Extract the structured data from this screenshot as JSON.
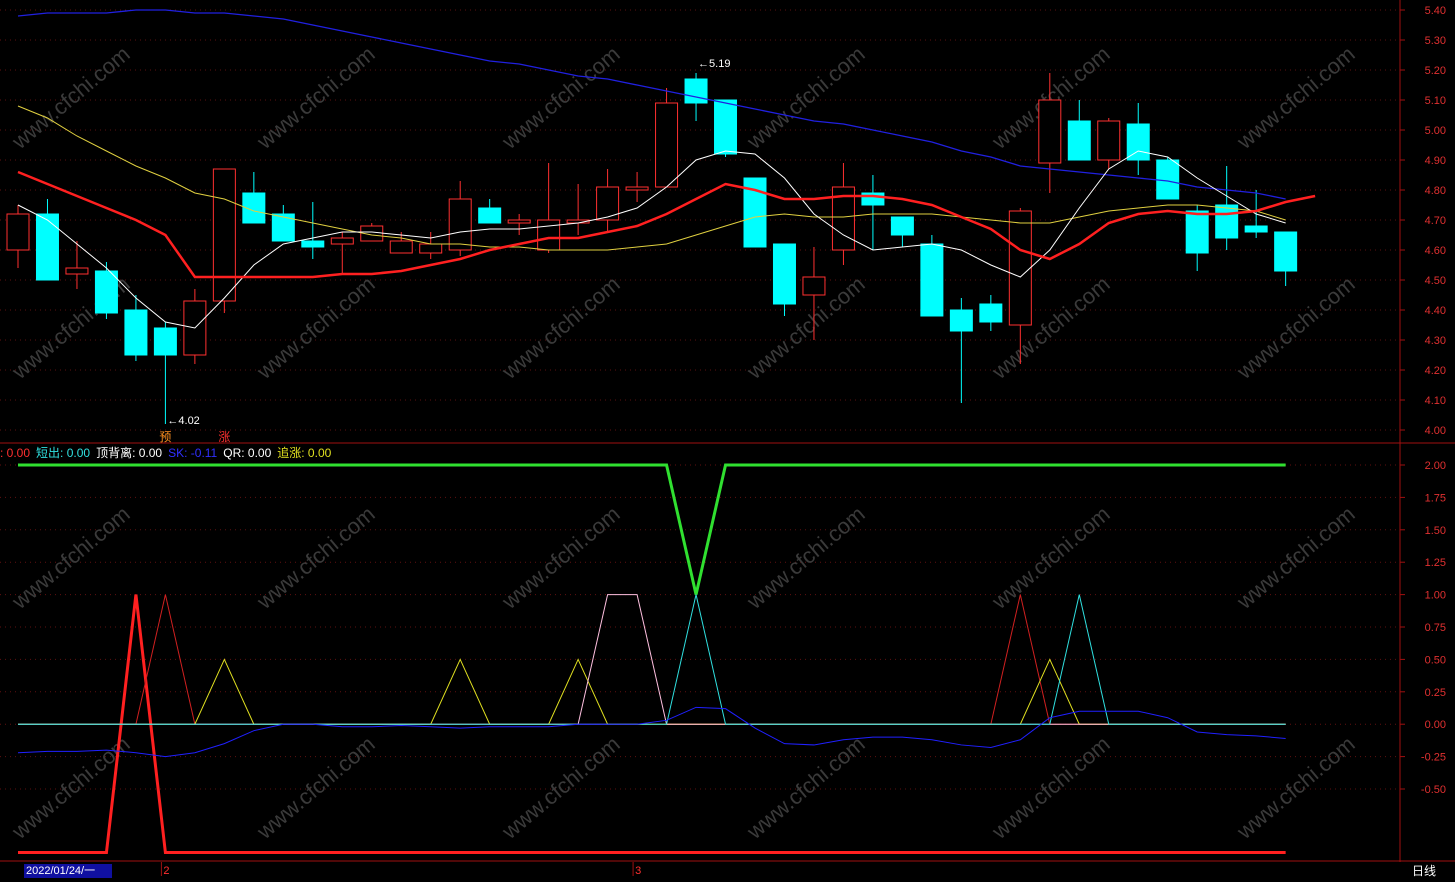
{
  "chart_data": [
    {
      "type": "candlestick",
      "ylim": [
        3.96,
        5.4
      ],
      "y_ticks": [
        "5.40",
        "5.30",
        "5.20",
        "5.10",
        "5.00",
        "4.90",
        "4.80",
        "4.70",
        "4.60",
        "4.50",
        "4.40",
        "4.30",
        "4.20",
        "4.10",
        "4.00"
      ],
      "candles": [
        {
          "o": 4.6,
          "h": 4.75,
          "l": 4.54,
          "c": 4.72
        },
        {
          "o": 4.72,
          "h": 4.77,
          "l": 4.5,
          "c": 4.5
        },
        {
          "o": 4.52,
          "h": 4.63,
          "l": 4.47,
          "c": 4.54
        },
        {
          "o": 4.53,
          "h": 4.56,
          "l": 4.37,
          "c": 4.39
        },
        {
          "o": 4.4,
          "h": 4.45,
          "l": 4.23,
          "c": 4.25
        },
        {
          "o": 4.34,
          "h": 4.36,
          "l": 4.02,
          "c": 4.25
        },
        {
          "o": 4.25,
          "h": 4.47,
          "l": 4.22,
          "c": 4.43
        },
        {
          "o": 4.43,
          "h": 4.87,
          "l": 4.39,
          "c": 4.87
        },
        {
          "o": 4.79,
          "h": 4.86,
          "l": 4.69,
          "c": 4.69
        },
        {
          "o": 4.72,
          "h": 4.75,
          "l": 4.63,
          "c": 4.63
        },
        {
          "o": 4.63,
          "h": 4.76,
          "l": 4.57,
          "c": 4.61
        },
        {
          "o": 4.62,
          "h": 4.66,
          "l": 4.52,
          "c": 4.64
        },
        {
          "o": 4.63,
          "h": 4.69,
          "l": 4.63,
          "c": 4.68
        },
        {
          "o": 4.59,
          "h": 4.66,
          "l": 4.59,
          "c": 4.63
        },
        {
          "o": 4.59,
          "h": 4.66,
          "l": 4.57,
          "c": 4.62
        },
        {
          "o": 4.6,
          "h": 4.83,
          "l": 4.58,
          "c": 4.77
        },
        {
          "o": 4.74,
          "h": 4.77,
          "l": 4.69,
          "c": 4.69
        },
        {
          "o": 4.69,
          "h": 4.72,
          "l": 4.65,
          "c": 4.7
        },
        {
          "o": 4.6,
          "h": 4.89,
          "l": 4.59,
          "c": 4.7
        },
        {
          "o": 4.69,
          "h": 4.82,
          "l": 4.65,
          "c": 4.7
        },
        {
          "o": 4.7,
          "h": 4.87,
          "l": 4.66,
          "c": 4.81
        },
        {
          "o": 4.8,
          "h": 4.86,
          "l": 4.76,
          "c": 4.81
        },
        {
          "o": 4.81,
          "h": 5.14,
          "l": 4.81,
          "c": 5.09
        },
        {
          "o": 5.17,
          "h": 5.19,
          "l": 5.03,
          "c": 5.09
        },
        {
          "o": 5.1,
          "h": 5.1,
          "l": 4.91,
          "c": 4.92
        },
        {
          "o": 4.84,
          "h": 4.84,
          "l": 4.61,
          "c": 4.61
        },
        {
          "o": 4.62,
          "h": 4.62,
          "l": 4.38,
          "c": 4.42
        },
        {
          "o": 4.45,
          "h": 4.61,
          "l": 4.3,
          "c": 4.51
        },
        {
          "o": 4.6,
          "h": 4.89,
          "l": 4.55,
          "c": 4.81
        },
        {
          "o": 4.79,
          "h": 4.85,
          "l": 4.6,
          "c": 4.75
        },
        {
          "o": 4.71,
          "h": 4.71,
          "l": 4.61,
          "c": 4.65
        },
        {
          "o": 4.62,
          "h": 4.65,
          "l": 4.38,
          "c": 4.38
        },
        {
          "o": 4.4,
          "h": 4.44,
          "l": 4.09,
          "c": 4.33
        },
        {
          "o": 4.42,
          "h": 4.45,
          "l": 4.33,
          "c": 4.36
        },
        {
          "o": 4.35,
          "h": 4.74,
          "l": 4.22,
          "c": 4.73
        },
        {
          "o": 4.89,
          "h": 5.19,
          "l": 4.79,
          "c": 5.1
        },
        {
          "o": 5.03,
          "h": 5.1,
          "l": 4.91,
          "c": 4.9
        },
        {
          "o": 4.9,
          "h": 5.04,
          "l": 4.87,
          "c": 5.03
        },
        {
          "o": 5.02,
          "h": 5.09,
          "l": 4.85,
          "c": 4.9
        },
        {
          "o": 4.9,
          "h": 4.91,
          "l": 4.79,
          "c": 4.77
        },
        {
          "o": 4.73,
          "h": 4.75,
          "l": 4.53,
          "c": 4.59
        },
        {
          "o": 4.75,
          "h": 4.88,
          "l": 4.6,
          "c": 4.64
        },
        {
          "o": 4.68,
          "h": 4.8,
          "l": 4.64,
          "c": 4.66
        },
        {
          "o": 4.66,
          "h": 4.66,
          "l": 4.48,
          "c": 4.53
        }
      ],
      "ma_white": [
        4.75,
        4.7,
        4.62,
        4.54,
        4.44,
        4.36,
        4.34,
        4.44,
        4.55,
        4.62,
        4.64,
        4.66,
        4.66,
        4.65,
        4.64,
        4.66,
        4.67,
        4.67,
        4.68,
        4.69,
        4.71,
        4.74,
        4.81,
        4.9,
        4.93,
        4.92,
        4.84,
        4.72,
        4.65,
        4.6,
        4.61,
        4.62,
        4.6,
        4.55,
        4.51,
        4.6,
        4.74,
        4.87,
        4.93,
        4.91,
        4.84,
        4.78,
        4.72,
        4.69
      ],
      "ma_red": [
        4.86,
        4.82,
        4.78,
        4.74,
        4.7,
        4.65,
        4.51,
        4.51,
        4.51,
        4.51,
        4.51,
        4.52,
        4.52,
        4.53,
        4.55,
        4.57,
        4.6,
        4.62,
        4.64,
        4.64,
        4.66,
        4.68,
        4.72,
        4.77,
        4.82,
        4.8,
        4.77,
        4.77,
        4.78,
        4.78,
        4.77,
        4.75,
        4.71,
        4.67,
        4.6,
        4.57,
        4.62,
        4.69,
        4.72,
        4.73,
        4.72,
        4.72,
        4.73,
        4.76,
        4.78
      ],
      "ma_yellow": [
        5.08,
        5.04,
        4.98,
        4.93,
        4.88,
        4.84,
        4.79,
        4.77,
        4.73,
        4.71,
        4.69,
        4.67,
        4.65,
        4.64,
        4.62,
        4.62,
        4.61,
        4.61,
        4.6,
        4.6,
        4.6,
        4.61,
        4.62,
        4.65,
        4.68,
        4.71,
        4.72,
        4.71,
        4.71,
        4.72,
        4.72,
        4.72,
        4.71,
        4.7,
        4.69,
        4.69,
        4.71,
        4.73,
        4.74,
        4.75,
        4.75,
        4.74,
        4.73,
        4.7
      ],
      "ma_blue": [
        5.38,
        5.39,
        5.39,
        5.39,
        5.4,
        5.4,
        5.39,
        5.39,
        5.38,
        5.37,
        5.35,
        5.33,
        5.31,
        5.29,
        5.27,
        5.25,
        5.23,
        5.22,
        5.2,
        5.18,
        5.17,
        5.15,
        5.13,
        5.11,
        5.09,
        5.07,
        5.05,
        5.03,
        5.02,
        5.0,
        4.98,
        4.96,
        4.93,
        4.91,
        4.88,
        4.87,
        4.86,
        4.85,
        4.84,
        4.83,
        4.81,
        4.8,
        4.79,
        4.77
      ],
      "annotations": [
        {
          "text": "5.19",
          "candle": 23,
          "value": 5.19
        },
        {
          "text": "4.02",
          "candle": 5,
          "value": 4.02
        }
      ],
      "markers": [
        {
          "text": "预",
          "candle": 5,
          "color": "#ff9020"
        },
        {
          "text": "涨",
          "candle": 7,
          "color": "#ff3030"
        }
      ]
    },
    {
      "type": "line",
      "ylim": [
        -1.0,
        2.1
      ],
      "y_ticks": [
        "2.00",
        "1.75",
        "1.50",
        "1.25",
        "1.00",
        "0.75",
        "0.50",
        "0.25",
        "0.00",
        "-0.25",
        "-0.50"
      ],
      "legend": [
        {
          "text": ": 0.00",
          "color": "#ff3030"
        },
        {
          "text": "短出: 0.00",
          "color": "#30e0e0"
        },
        {
          "text": "顶背离: 0.00",
          "color": "#ffffff"
        },
        {
          "text": "SK: -0.11",
          "color": "#3030ff"
        },
        {
          "text": "QR: 0.00",
          "color": "#ffffff"
        },
        {
          "text": "追涨: 0.00",
          "color": "#e0e020"
        }
      ],
      "series": [
        {
          "color": "#30e030",
          "values": [
            2,
            2,
            2,
            2,
            2,
            2,
            2,
            2,
            2,
            2,
            2,
            2,
            2,
            2,
            2,
            2,
            2,
            2,
            2,
            2,
            2,
            2,
            2,
            1,
            2,
            2,
            2,
            2,
            2,
            2,
            2,
            2,
            2,
            2,
            2,
            2,
            2,
            2,
            2,
            2,
            2,
            2,
            2,
            2
          ]
        },
        {
          "color": "#ff2020",
          "values": [
            -0.99,
            -0.99,
            -0.99,
            -0.99,
            1,
            -0.99,
            -0.99,
            -0.99,
            -0.99,
            -0.99,
            -0.99,
            -0.99,
            -0.99,
            -0.99,
            -0.99,
            -0.99,
            -0.99,
            -0.99,
            -0.99,
            -0.99,
            -0.99,
            -0.99,
            -0.99,
            -0.99,
            -0.99,
            -0.99,
            -0.99,
            -0.99,
            -0.99,
            -0.99,
            -0.99,
            -0.99,
            -0.99,
            -0.99,
            -0.99,
            -0.99,
            -0.99,
            -0.99,
            -0.99,
            -0.99,
            -0.99,
            -0.99,
            -0.99,
            -0.99
          ]
        },
        {
          "color": "#d02020",
          "values": [
            0,
            0,
            0,
            0,
            0,
            1,
            0,
            0,
            0,
            0,
            0,
            0,
            0,
            0,
            0,
            0,
            0,
            0,
            0,
            0,
            0,
            0,
            0,
            0,
            0,
            0,
            0,
            0,
            0,
            0,
            0,
            0,
            0,
            0,
            1,
            0,
            0,
            0,
            0,
            0,
            0,
            0,
            0,
            0
          ]
        },
        {
          "color": "#e0e020",
          "values": [
            0,
            0,
            0,
            0,
            0,
            0,
            0,
            0.5,
            0,
            0,
            0,
            0,
            0,
            0,
            0,
            0.5,
            0,
            0,
            0,
            0.5,
            0,
            0,
            0,
            0,
            0,
            0,
            0,
            0,
            0,
            0,
            0,
            0,
            0,
            0,
            0,
            0.5,
            0,
            0,
            0,
            0,
            0,
            0,
            0,
            0
          ]
        },
        {
          "color": "#ffc0e0",
          "values": [
            0,
            0,
            0,
            0,
            0,
            0,
            0,
            0,
            0,
            0,
            0,
            0,
            0,
            0,
            0,
            0,
            0,
            0,
            0,
            0,
            1,
            1,
            0,
            0,
            0,
            0,
            0,
            0,
            0,
            0,
            0,
            0,
            0,
            0,
            0,
            0,
            0,
            0,
            0,
            0,
            0,
            0,
            0,
            0
          ]
        },
        {
          "color": "#30e0e0",
          "values": [
            0,
            0,
            0,
            0,
            0,
            0,
            0,
            0,
            0,
            0,
            0,
            0,
            0,
            0,
            0,
            0,
            0,
            0,
            0,
            0,
            0,
            0,
            0,
            1,
            0,
            0,
            0,
            0,
            0,
            0,
            0,
            0,
            0,
            0,
            0,
            0,
            1,
            0,
            0,
            0,
            0,
            0,
            0,
            0
          ]
        },
        {
          "color": "#2020ff",
          "values": [
            -0.22,
            -0.21,
            -0.21,
            -0.2,
            -0.22,
            -0.25,
            -0.22,
            -0.15,
            -0.05,
            0.0,
            0.0,
            -0.02,
            -0.02,
            -0.01,
            -0.02,
            -0.03,
            -0.02,
            -0.02,
            -0.02,
            0.0,
            0.0,
            0.0,
            0.03,
            0.13,
            0.12,
            -0.03,
            -0.15,
            -0.16,
            -0.12,
            -0.1,
            -0.1,
            -0.12,
            -0.16,
            -0.18,
            -0.12,
            0.05,
            0.1,
            0.1,
            0.1,
            0.05,
            -0.06,
            -0.08,
            -0.09,
            -0.11
          ]
        }
      ]
    }
  ],
  "xaxis": {
    "date_label": "2022/01/24/一",
    "month_labels": [
      {
        "text": "2",
        "candle": 5
      },
      {
        "text": "3",
        "candle": 21
      }
    ],
    "period": "日线"
  },
  "watermark": "www.cfchi.com"
}
